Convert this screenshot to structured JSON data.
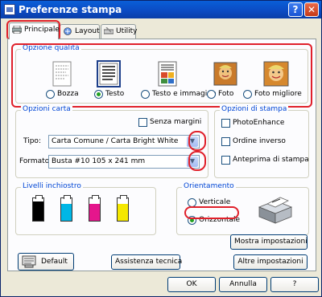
{
  "window": {
    "title": "Preferenze stampa",
    "help_button": "?",
    "close_button": "✕"
  },
  "tabs": [
    {
      "label": "Principale",
      "icon": "printer-icon",
      "active": true
    },
    {
      "label": "Layout",
      "icon": "layout-icon",
      "active": false
    },
    {
      "label": "Utility",
      "icon": "utility-icon",
      "active": false
    }
  ],
  "quality": {
    "legend": "Opzione qualità",
    "selected": "Testo",
    "options": [
      {
        "label": "Bozza",
        "icon": "draft-document-icon"
      },
      {
        "label": "Testo",
        "icon": "text-document-icon"
      },
      {
        "label": "Testo e immagine",
        "icon": "text-image-document-icon"
      },
      {
        "label": "Foto",
        "icon": "photo-icon"
      },
      {
        "label": "Foto migliore",
        "icon": "best-photo-icon"
      }
    ]
  },
  "paper": {
    "legend": "Opzioni carta",
    "borderless_label": "Senza margini",
    "type_label": "Tipo:",
    "type_value": "Carta Comune / Carta Bright White",
    "format_label": "Formato:",
    "format_value": "Busta #10 105 x 241 mm"
  },
  "print_options": {
    "legend": "Opzioni di stampa",
    "items": [
      "PhotoEnhance",
      "Ordine inverso",
      "Anteprima di stampa"
    ]
  },
  "ink": {
    "legend": "Livelli inchiostro",
    "cartridges": [
      {
        "color": "#000000",
        "level": 0.85
      },
      {
        "color": "#00b7e6",
        "level": 0.75
      },
      {
        "color": "#e5168c",
        "level": 0.75
      },
      {
        "color": "#f5e800",
        "level": 0.75
      }
    ]
  },
  "orientation": {
    "legend": "Orientamento",
    "options": [
      "Verticale",
      "Orizzontale"
    ],
    "selected": "Orizzontale"
  },
  "buttons": {
    "show_settings": "Mostra impostazioni",
    "default": "Default",
    "tech_support": "Assistenza tecnica",
    "other_settings": "Altre impostazioni",
    "ok": "OK",
    "cancel": "Annulla",
    "help": "?"
  },
  "colors": {
    "highlight": "#e0202a",
    "titlebar": "#0a4ac2",
    "legend_text": "#0046d5"
  }
}
